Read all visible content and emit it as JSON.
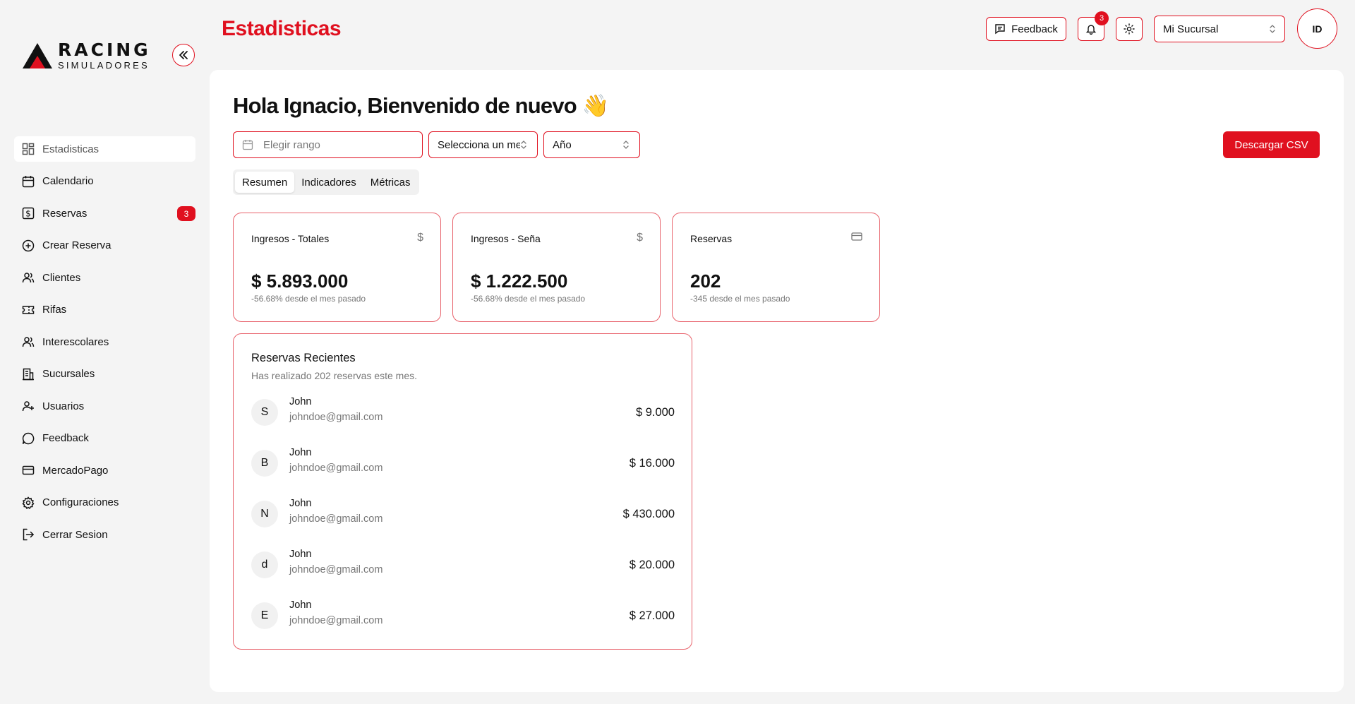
{
  "brand": {
    "title": "RACING",
    "subtitle": "SIMULADORES",
    "accent": "#e0101f"
  },
  "sidebar": {
    "items": [
      {
        "label": "Estadisticas",
        "icon": "dashboard-icon",
        "active": true
      },
      {
        "label": "Calendario",
        "icon": "calendar-icon"
      },
      {
        "label": "Reservas",
        "icon": "dollar-square-icon",
        "badge": "3"
      },
      {
        "label": "Crear Reserva",
        "icon": "plus-circle-icon"
      },
      {
        "label": "Clientes",
        "icon": "users-icon"
      },
      {
        "label": "Rifas",
        "icon": "ticket-icon"
      },
      {
        "label": "Interescolares",
        "icon": "users-icon"
      },
      {
        "label": "Sucursales",
        "icon": "building-icon"
      },
      {
        "label": "Usuarios",
        "icon": "user-plus-icon"
      },
      {
        "label": "Feedback",
        "icon": "message-circle-icon"
      },
      {
        "label": "MercadoPago",
        "icon": "credit-card-icon"
      },
      {
        "label": "Configuraciones",
        "icon": "gear-icon"
      },
      {
        "label": "Cerrar Sesion",
        "icon": "logout-icon"
      }
    ]
  },
  "header": {
    "title": "Estadisticas",
    "feedback_label": "Feedback",
    "notifications_count": "3",
    "branch_select": "Mi Sucursal",
    "avatar_initials": "ID"
  },
  "main": {
    "greeting": "Hola Ignacio, Bienvenido de nuevo 👋",
    "filters": {
      "range_placeholder": "Elegir rango",
      "month_placeholder": "Selecciona un mes",
      "year_placeholder": "Año"
    },
    "csv_button": "Descargar CSV",
    "tabs": [
      "Resumen",
      "Indicadores",
      "Métricas"
    ],
    "stats": [
      {
        "title": "Ingresos - Totales",
        "icon": "$",
        "value": "$ 5.893.000",
        "sub": "-56.68% desde el mes pasado"
      },
      {
        "title": "Ingresos - Seña",
        "icon": "$",
        "value": "$ 1.222.500",
        "sub": "-56.68% desde el mes pasado"
      },
      {
        "title": "Reservas",
        "icon": "credit-card-icon",
        "value": "202",
        "sub": "-345 desde el mes pasado"
      }
    ],
    "recent": {
      "title": "Reservas Recientes",
      "subtitle": "Has realizado 202 reservas este mes.",
      "rows": [
        {
          "initial": "S",
          "name": "John",
          "email": "johndoe@gmail.com",
          "amount": "$ 9.000"
        },
        {
          "initial": "B",
          "name": "John",
          "email": "johndoe@gmail.com",
          "amount": "$ 16.000"
        },
        {
          "initial": "N",
          "name": "John",
          "email": "johndoe@gmail.com",
          "amount": "$ 430.000"
        },
        {
          "initial": "d",
          "name": "John",
          "email": "johndoe@gmail.com",
          "amount": "$ 20.000"
        },
        {
          "initial": "E",
          "name": "John",
          "email": "johndoe@gmail.com",
          "amount": "$ 27.000"
        }
      ]
    }
  }
}
